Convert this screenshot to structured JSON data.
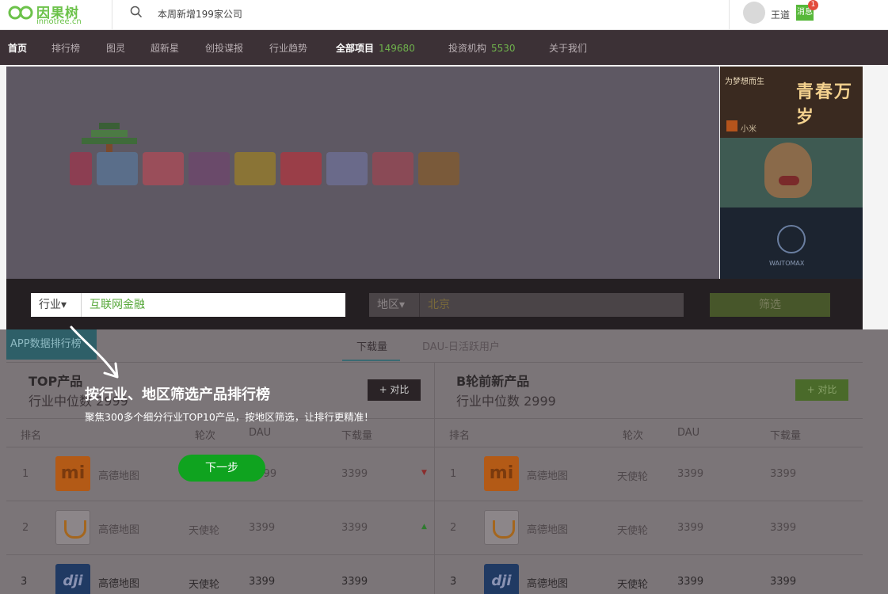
{
  "header": {
    "logo_text": "因果树",
    "logo_sub": "innotree.cn",
    "search_text": "本周新增199家公司",
    "username": "王道",
    "badge_count": "1",
    "msg_label": "消息"
  },
  "nav": {
    "items": [
      {
        "label": "首页"
      },
      {
        "label": "排行榜"
      },
      {
        "label": "图灵"
      },
      {
        "label": "超新星"
      },
      {
        "label": "创投谍报"
      },
      {
        "label": "行业趋势"
      },
      {
        "label": "全部项目",
        "count": "149680"
      },
      {
        "label": "投资机构",
        "count": "5530"
      },
      {
        "label": "关于我们"
      }
    ]
  },
  "banner": {
    "ad1_caption": "为梦想而生",
    "ad1_title": "青春万岁",
    "ad1_brand": "小米",
    "ad3_caption": "WAITOMAX"
  },
  "filter": {
    "industry_label": "行业▾",
    "industry_value": "互联网金融",
    "region_label": "地区▾",
    "region_value": "北京",
    "submit_label": "筛选"
  },
  "ranking": {
    "tag_label": "APP数据排行榜",
    "tabs": [
      "下载量",
      "DAU-日活跃用户"
    ],
    "left": {
      "title": "TOP产品",
      "subtitle": "行业中位数 2999",
      "compare_label": "+ 对比"
    },
    "right": {
      "title": "B轮前新产品",
      "subtitle": "行业中位数 2999",
      "compare_label": "+ 对比"
    },
    "columns": [
      "排名",
      "轮次",
      "DAU",
      "下载量"
    ],
    "left_rows": [
      {
        "rank": "1",
        "name": "高德地图",
        "round": "",
        "dau": "3399",
        "downloads": "3399",
        "trend": "down"
      },
      {
        "rank": "2",
        "name": "高德地图",
        "round": "天使轮",
        "dau": "3399",
        "downloads": "3399",
        "trend": "up"
      },
      {
        "rank": "3",
        "name": "高德地图",
        "round": "天使轮",
        "dau": "3399",
        "downloads": "3399",
        "trend": ""
      }
    ],
    "right_rows": [
      {
        "rank": "1",
        "name": "高德地图",
        "round": "天使轮",
        "dau": "3399",
        "downloads": "3399"
      },
      {
        "rank": "2",
        "name": "高德地图",
        "round": "天使轮",
        "dau": "3399",
        "downloads": "3399"
      },
      {
        "rank": "3",
        "name": "高德地图",
        "round": "天使轮",
        "dau": "3399",
        "downloads": "3399"
      }
    ]
  },
  "guide": {
    "title": "按行业、地区筛选产品排行榜",
    "description": "聚焦300多个细分行业TOP10产品，按地区筛选，让排行更精准！",
    "next_label": "下一步"
  },
  "colors": {
    "brand_green": "#6cc24a",
    "nav_bg": "#3c3136",
    "next_button": "#0fa31f"
  }
}
